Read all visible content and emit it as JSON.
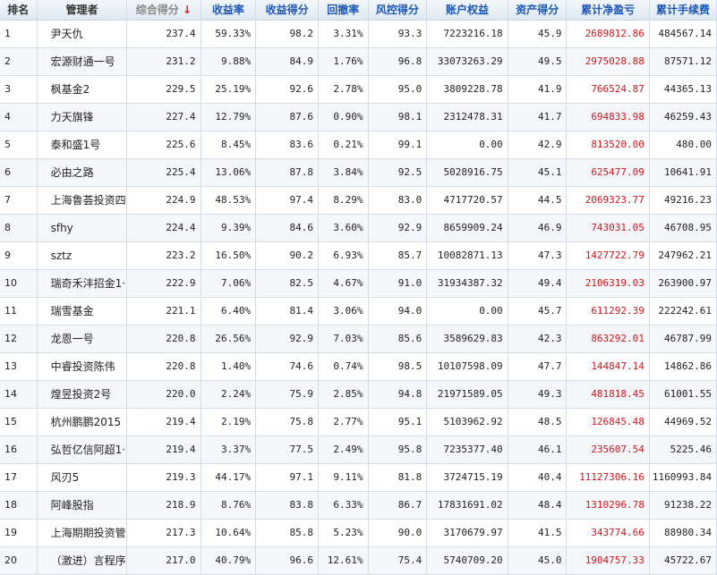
{
  "columns": [
    {
      "label": "排名",
      "sortable": false
    },
    {
      "label": "管理者",
      "sortable": false
    },
    {
      "label": "综合得分",
      "sortable": true,
      "active": true,
      "sort_arrow": "↓"
    },
    {
      "label": "收益率",
      "sortable": true
    },
    {
      "label": "收益得分",
      "sortable": true
    },
    {
      "label": "回撤率",
      "sortable": true
    },
    {
      "label": "风控得分",
      "sortable": true
    },
    {
      "label": "账户权益",
      "sortable": true
    },
    {
      "label": "资产得分",
      "sortable": true
    },
    {
      "label": "累计净盈亏",
      "sortable": true
    },
    {
      "label": "累计手续费",
      "sortable": true
    }
  ],
  "rows": [
    [
      "1",
      "尹天仇",
      "237.4",
      "59.33%",
      "98.2",
      "3.31%",
      "93.3",
      "7223216.18",
      "45.9",
      "2689812.86",
      "484567.14"
    ],
    [
      "2",
      "宏源财通一号",
      "231.2",
      "9.88%",
      "84.9",
      "1.76%",
      "96.8",
      "33073263.29",
      "49.5",
      "2975028.88",
      "87571.12"
    ],
    [
      "3",
      "枫基金2",
      "229.5",
      "25.19%",
      "92.6",
      "2.78%",
      "95.0",
      "3809228.78",
      "41.9",
      "766524.87",
      "44365.13"
    ],
    [
      "4",
      "力天旗锋",
      "227.4",
      "12.79%",
      "87.6",
      "0.90%",
      "98.1",
      "2312478.31",
      "41.7",
      "694833.98",
      "46259.43"
    ],
    [
      "5",
      "泰和盛1号",
      "225.6",
      "8.45%",
      "83.6",
      "0.21%",
      "99.1",
      "0.00",
      "42.9",
      "813520.00",
      "480.00"
    ],
    [
      "6",
      "必由之路",
      "225.4",
      "13.06%",
      "87.8",
      "3.84%",
      "92.5",
      "5028916.75",
      "45.1",
      "625477.09",
      "10641.91"
    ],
    [
      "7",
      "上海鲁荟投资四",
      "224.9",
      "48.53%",
      "97.4",
      "8.29%",
      "83.0",
      "4717720.57",
      "44.5",
      "2069323.77",
      "49216.23"
    ],
    [
      "8",
      "sfhy",
      "224.4",
      "9.39%",
      "84.6",
      "3.60%",
      "92.9",
      "8659909.24",
      "46.9",
      "743031.05",
      "46708.95"
    ],
    [
      "9",
      "sztz",
      "223.2",
      "16.50%",
      "90.2",
      "6.93%",
      "85.7",
      "10082871.13",
      "47.3",
      "1427722.79",
      "247962.21"
    ],
    [
      "10",
      "瑞奇禾沣招金1·",
      "222.9",
      "7.06%",
      "82.5",
      "4.67%",
      "91.0",
      "31934387.32",
      "49.4",
      "2106319.03",
      "263900.97"
    ],
    [
      "11",
      "瑞雪基金",
      "221.1",
      "6.40%",
      "81.4",
      "3.06%",
      "94.0",
      "0.00",
      "45.7",
      "611292.39",
      "222242.61"
    ],
    [
      "12",
      "龙恩一号",
      "220.8",
      "26.56%",
      "92.9",
      "7.03%",
      "85.6",
      "3589629.83",
      "42.3",
      "863292.01",
      "46787.99"
    ],
    [
      "13",
      "中睿投资陈伟",
      "220.8",
      "1.40%",
      "74.6",
      "0.74%",
      "98.5",
      "10107598.09",
      "47.7",
      "144847.14",
      "14862.86"
    ],
    [
      "14",
      "煌昱投资2号",
      "220.0",
      "2.24%",
      "75.9",
      "2.85%",
      "94.8",
      "21971589.05",
      "49.3",
      "481818.45",
      "61001.55"
    ],
    [
      "15",
      "杭州鹏鹏2015",
      "219.4",
      "2.19%",
      "75.8",
      "2.77%",
      "95.1",
      "5103962.92",
      "48.5",
      "126845.48",
      "44969.52"
    ],
    [
      "16",
      "弘哲亿信阿超1·",
      "219.4",
      "3.37%",
      "77.5",
      "2.49%",
      "95.8",
      "7235377.40",
      "46.1",
      "235607.54",
      "5225.46"
    ],
    [
      "17",
      "风刃5",
      "219.3",
      "44.17%",
      "97.1",
      "9.11%",
      "81.8",
      "3724715.19",
      "40.4",
      "11127306.16",
      "1160993.84"
    ],
    [
      "18",
      "阿峰股指",
      "218.9",
      "8.76%",
      "83.8",
      "6.33%",
      "86.7",
      "17831691.02",
      "48.4",
      "1310296.78",
      "91238.22"
    ],
    [
      "19",
      "上海期期投资管",
      "217.3",
      "10.64%",
      "85.8",
      "5.23%",
      "90.0",
      "3170679.97",
      "41.5",
      "343774.66",
      "88980.34"
    ],
    [
      "20",
      "（激进）言程序",
      "217.0",
      "40.79%",
      "96.6",
      "12.61%",
      "75.4",
      "5740709.20",
      "45.0",
      "1904757.33",
      "45722.67"
    ]
  ]
}
